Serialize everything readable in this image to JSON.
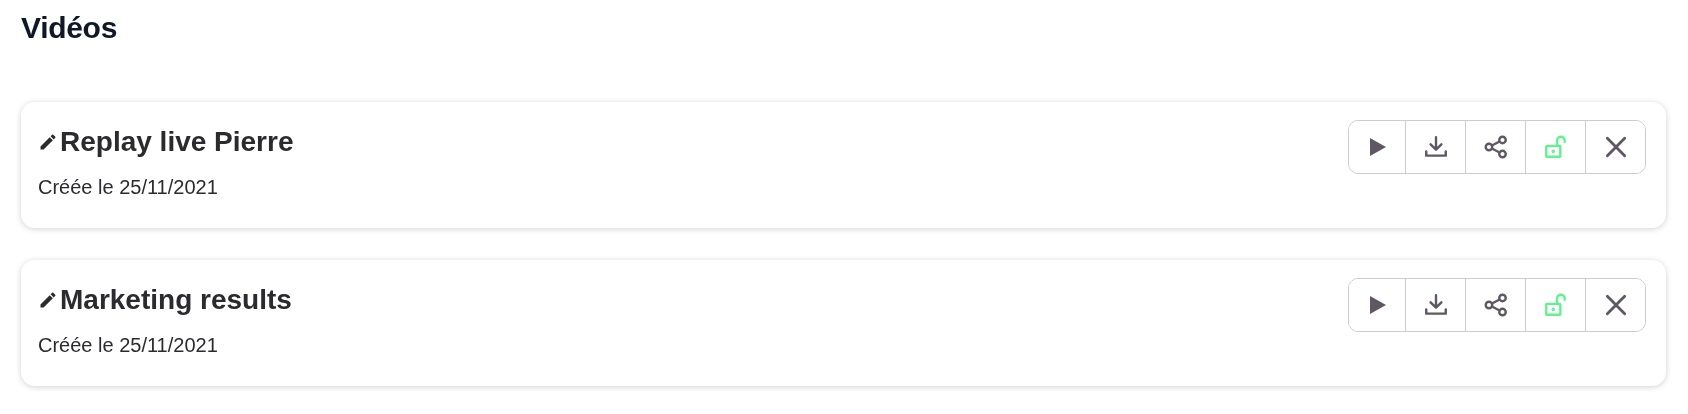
{
  "title": "Vidéos",
  "videos": [
    {
      "name": "Replay live Pierre",
      "created": "Créée le 25/11/2021",
      "locked": false
    },
    {
      "name": "Marketing results",
      "created": "Créée le 25/11/2021",
      "locked": false
    }
  ]
}
